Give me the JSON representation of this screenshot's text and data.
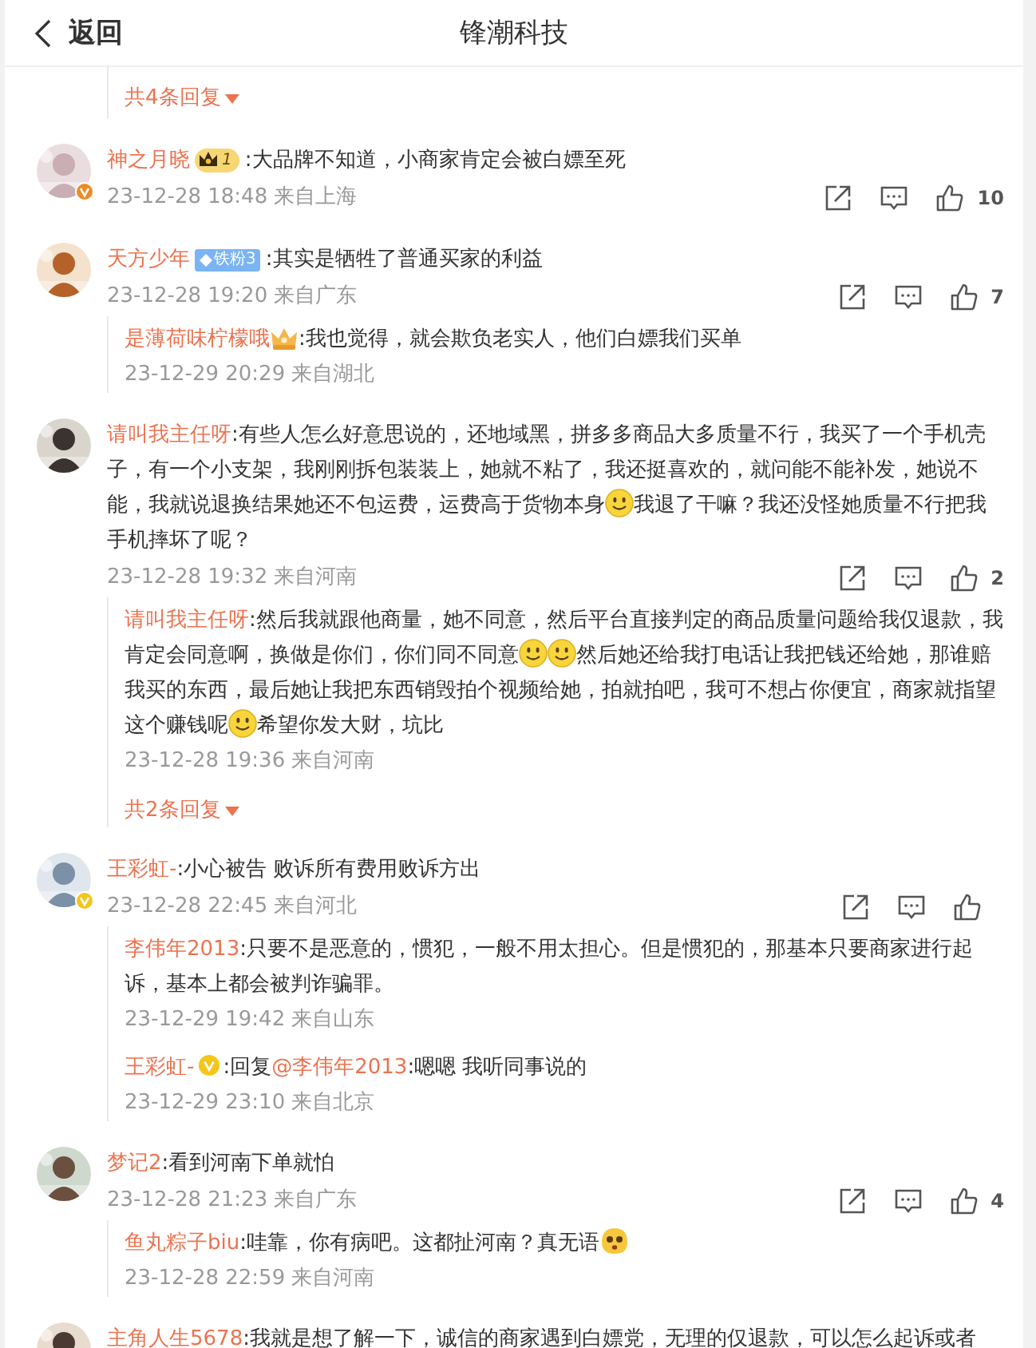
{
  "header": {
    "back": "返回",
    "title": "锋潮科技"
  },
  "top_thread": {
    "more_replies": "共4条回复"
  },
  "comments": [
    {
      "user": {
        "name": "神之月晓",
        "badge": {
          "kind": "crown-level",
          "text": "1"
        },
        "verified": {
          "color": "#f08a24"
        }
      },
      "text": [
        {
          "kind": "text",
          "text": ":大品牌不知道，小商家肯定会被白嫖至死"
        }
      ],
      "meta": "23-12-28 18:48 来自上海",
      "likes": "10"
    },
    {
      "user": {
        "name": "天方少年",
        "badge": {
          "kind": "fan",
          "text": "铁粉3"
        }
      },
      "text": [
        {
          "kind": "text",
          "text": ":其实是牺牲了普通买家的利益"
        }
      ],
      "meta": "23-12-28 19:20 来自广东",
      "likes": "7",
      "replies": [
        {
          "user": {
            "name": "是薄荷味柠檬哦",
            "badge": {
              "kind": "crown"
            }
          },
          "text": [
            {
              "kind": "text",
              "text": ":我也觉得，就会欺负老实人，他们白嫖我们买单"
            }
          ],
          "meta": "23-12-29 20:29 来自湖北"
        }
      ]
    },
    {
      "user": {
        "name": "请叫我主任呀"
      },
      "text": [
        {
          "kind": "text",
          "text": ":有些人怎么好意思说的，还地域黑，拼多多商品大多质量不行，我买了一个手机壳子，有一个小支架，我刚刚拆包装装上，她就不粘了，我还挺喜欢的，就问能不能补发，她说不能，我就说退换结果她还不包运费，运费高于货物本身"
        },
        {
          "kind": "smiley"
        },
        {
          "kind": "text",
          "text": "我退了干嘛？我还没怪她质量不行把我手机摔坏了呢？"
        }
      ],
      "meta": "23-12-28 19:32 来自河南",
      "likes": "2",
      "replies": [
        {
          "user": {
            "name": "请叫我主任呀"
          },
          "text": [
            {
              "kind": "text",
              "text": ":然后我就跟他商量，她不同意，然后平台直接判定的商品质量问题给我仅退款，我肯定会同意啊，换做是你们，你们同不同意"
            },
            {
              "kind": "smiley"
            },
            {
              "kind": "smiley"
            },
            {
              "kind": "text",
              "text": "然后她还给我打电话让我把钱还给她，那谁赔我买的东西，最后她让我把东西销毁拍个视频给她，拍就拍吧，我可不想占你便宜，商家就指望这个赚钱呢"
            },
            {
              "kind": "smiley"
            },
            {
              "kind": "text",
              "text": "希望你发大财，坑比"
            }
          ],
          "meta": "23-12-28 19:36 来自河南"
        }
      ],
      "more_replies": "共2条回复"
    },
    {
      "user": {
        "name": "王彩虹-",
        "verified": {
          "color": "#f5c518"
        }
      },
      "text": [
        {
          "kind": "text",
          "text": ":小心被告 败诉所有费用败诉方出"
        }
      ],
      "meta": "23-12-28 22:45 来自河北",
      "replies": [
        {
          "user": {
            "name": "李伟年2013"
          },
          "text": [
            {
              "kind": "text",
              "text": ":只要不是恶意的，惯犯，一般不用太担心。但是惯犯的，那基本只要商家进行起诉，基本上都会被判诈骗罪。"
            }
          ],
          "meta": "23-12-29 19:42 来自山东"
        },
        {
          "user": {
            "name": "王彩虹-",
            "badge": {
              "kind": "verified"
            }
          },
          "text": [
            {
              "kind": "text",
              "text": ":回复"
            },
            {
              "kind": "mention",
              "text": "@李伟年2013"
            },
            {
              "kind": "text",
              "text": ":嗯嗯 我听同事说的"
            }
          ],
          "meta": "23-12-29 23:10 来自北京"
        }
      ]
    },
    {
      "user": {
        "name": "梦记2"
      },
      "text": [
        {
          "kind": "text",
          "text": ":看到河南下单就怕"
        }
      ],
      "meta": "23-12-28 21:23 来自广东",
      "likes": "4",
      "replies": [
        {
          "user": {
            "name": "鱼丸粽子biu"
          },
          "text": [
            {
              "kind": "text",
              "text": ":哇靠，你有病吧。这都扯河南？真无语"
            },
            {
              "kind": "shocked"
            }
          ],
          "meta": "23-12-28 22:59 来自河南"
        }
      ]
    },
    {
      "user": {
        "name": "主角人生5678"
      },
      "text": [
        {
          "kind": "text",
          "text": ":我就是想了解一下，诚信的商家遇到白嫖党，无理的仅退款，可以怎么起诉或者"
        }
      ]
    }
  ]
}
